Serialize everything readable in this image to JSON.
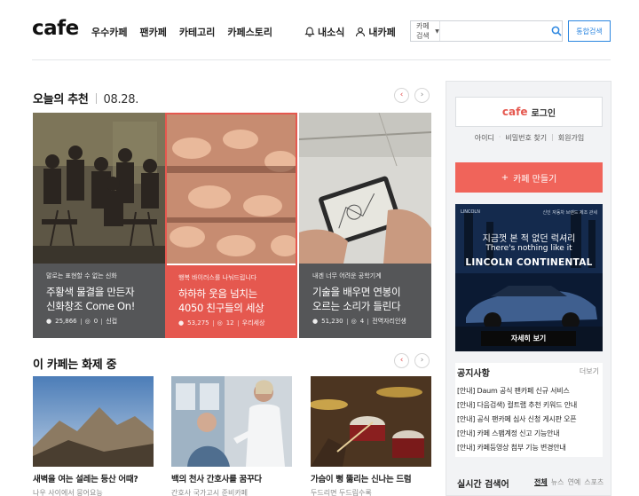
{
  "header": {
    "logo": "cafe",
    "gnb": [
      "우수카페",
      "팬카페",
      "카테고리",
      "카페스토리"
    ],
    "util": [
      {
        "label": "내소식",
        "icon": "bell-icon"
      },
      {
        "label": "내카페",
        "icon": "person-icon"
      }
    ],
    "search": {
      "scope": "카페검색",
      "placeholder": "",
      "button_icon": "search-icon"
    },
    "total_search": "통합검색"
  },
  "recommend": {
    "title": "오늘의 추천",
    "date": "08.28.",
    "cards": [
      {
        "sub": "말로는 표현할 수 없는 신화",
        "title_line1": "주황색 물결을 만든자",
        "title_line2": "신화창조 Come On!",
        "members": "25,866",
        "comments": "0",
        "tag": "신컵"
      },
      {
        "sub": "행복 바이러스를 나눠드립니다",
        "title_line1": "하하하 웃음 넘치는",
        "title_line2": "4050 친구들의 세상",
        "members": "53,275",
        "comments": "12",
        "tag": "우리세상"
      },
      {
        "sub": "내겐 너무 어려운 공학기계",
        "title_line1": "기술을 배우면 연봉이",
        "title_line2": "오르는 소리가 들린다",
        "members": "51,230",
        "comments": "4",
        "tag": "전역자리인생"
      }
    ]
  },
  "hot": {
    "title": "이 카페는 화제 중",
    "cards": [
      {
        "title": "새벽을 여는 설레는 등산 어때?",
        "sub": "나우 사이에서 뭉어요능"
      },
      {
        "title": "백의 천사 간호사를 꿈꾸다",
        "sub": "간호사 국가고시 준비카페"
      },
      {
        "title": "가슴이 뻥 뚫리는 신나는 드럼",
        "sub": "두드리면 두드림수록"
      }
    ]
  },
  "sidebar": {
    "login_brand": "cafe",
    "login_label": "로그인",
    "links": [
      "아이디",
      "비밀번호 찾기",
      "회원가입"
    ],
    "make_cafe": "카페 만들기",
    "ad": {
      "brand": "LINCOLN",
      "tag_right": "신인 자동차 브랜드 제조 관세",
      "line1": "지금껏 본 적 없던 럭셔리",
      "line2": "There's nothing like it",
      "model": "LINCOLN CONTINENTAL",
      "cta": "자세히 보기"
    },
    "notice": {
      "title": "공지사항",
      "more": "더보기",
      "items": [
        "[안내] Daum 공식 팬카페 신규 서비스",
        "[안내] 다음검색) 컬트랩 추천 키워드 안내",
        "[안내] 공식 팬카페 심사 신청 게시판 오픈",
        "[안내] 카페 스팸계정 신고 기능안내",
        "[안내] 카페등영상 첨부 기능 변경안내"
      ]
    },
    "realtime": {
      "title": "실시간 검색어",
      "tabs": [
        "전체",
        "뉴스",
        "연예",
        "스포츠"
      ]
    }
  },
  "colors": {
    "accent": "#e5584f",
    "dark_card": "#555658",
    "link_blue": "#2b86e0"
  }
}
